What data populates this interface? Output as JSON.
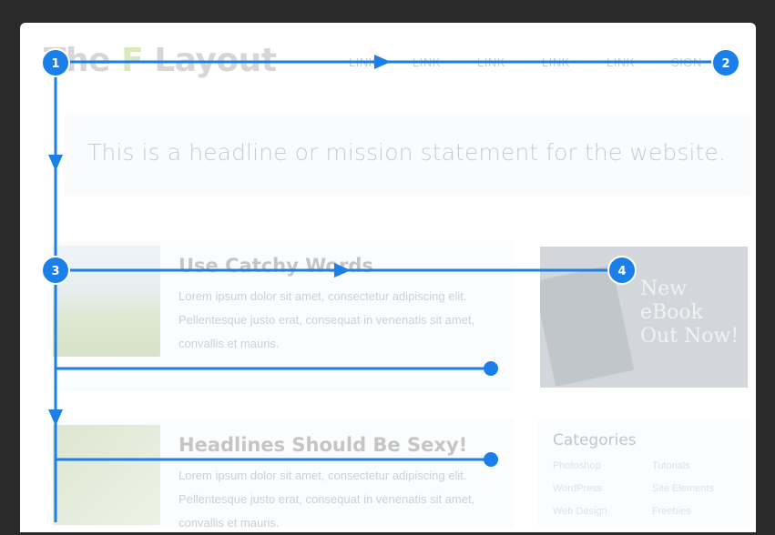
{
  "site": {
    "logo_prefix": "The ",
    "logo_mark": "F",
    "logo_suffix": " Layout",
    "nav": [
      "LINK",
      "LINK",
      "LINK",
      "LINK",
      "LINK",
      "SIGN"
    ]
  },
  "hero": {
    "headline": "This is a headline or mission statement for the website."
  },
  "articles": [
    {
      "title": "Use Catchy Words",
      "body": "Lorem ipsum dolor sit amet, consectetur adipiscing elit. Pellentesque justo erat, consequat in venenatis sit amet, convallis et mauris."
    },
    {
      "title": "Headlines Should Be Sexy!",
      "body": "Lorem ipsum dolor sit amet, consectetur adipiscing elit. Pellentesque justo erat, consequat in venenatis sit amet, convallis et mauris."
    }
  ],
  "sidebar": {
    "promo_text": "New eBook Out Now!",
    "categories_title": "Categories",
    "categories": [
      "Photoshop",
      "Tutorials",
      "WordPress",
      "Site Elements",
      "Web Design",
      "Freebies"
    ]
  },
  "markers": [
    "1",
    "2",
    "3",
    "4"
  ],
  "colors": {
    "accent": "#1a7fe8",
    "background": "#2a2a2a",
    "page": "#ffffff"
  }
}
